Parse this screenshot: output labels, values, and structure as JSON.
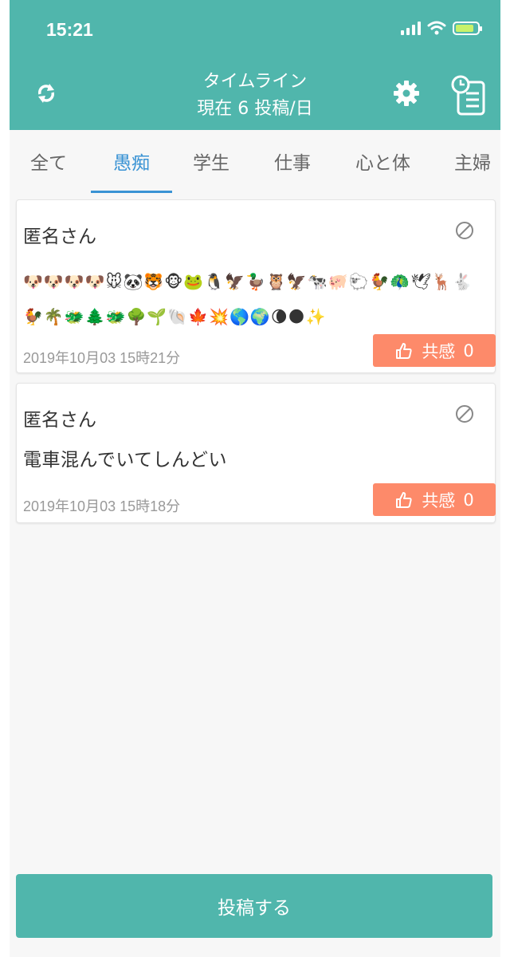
{
  "status_bar": {
    "time": "15:21"
  },
  "header": {
    "title": "タイムライン",
    "subtitle": "現在 6 投稿/日",
    "refresh_icon": "refresh-icon",
    "settings_icon": "gear-icon",
    "report_icon": "clock-document-icon"
  },
  "tabs": [
    {
      "label": "全て",
      "active": false
    },
    {
      "label": "愚痴",
      "active": true
    },
    {
      "label": "学生",
      "active": false
    },
    {
      "label": "仕事",
      "active": false
    },
    {
      "label": "心と体",
      "active": false
    },
    {
      "label": "主婦",
      "active": false
    }
  ],
  "posts": [
    {
      "author": "匿名さん",
      "body": "🐶🐶🐶🐶🐭🐼🐯🐵🐸🐧🦅🦆🦉🦅🐄🐖🐑🐓🦚🕊🦌🐇🐓🌴🐲🌲🐲🌳🌱🐚🍁💥🌎🌍🌘🌑✨",
      "date": "2019年10月03 15時21分",
      "empathy_label": "共感",
      "empathy_count": "0"
    },
    {
      "author": "匿名さん",
      "body": "電車混んでいてしんどい",
      "date": "2019年10月03 15時18分",
      "empathy_label": "共感",
      "empathy_count": "0"
    }
  ],
  "footer": {
    "post_button_label": "投稿する"
  },
  "colors": {
    "header_bg": "#50b6ac",
    "active_tab": "#3a93d4",
    "empathy_button": "#fd8a6a",
    "background": "#f7f7f7"
  }
}
